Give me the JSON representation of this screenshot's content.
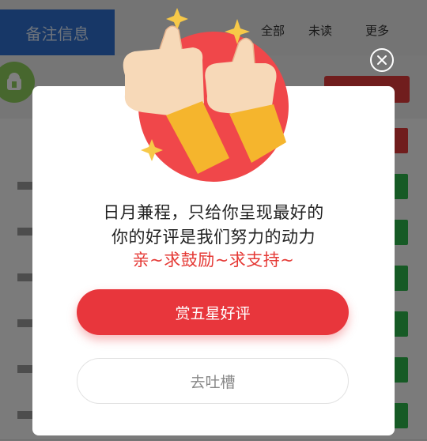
{
  "background": {
    "blue_button_label": "备注信息",
    "tabs": [
      "全部",
      "未读",
      "更多"
    ]
  },
  "dialog": {
    "message_line1": "日月兼程，只给你呈现最好的",
    "message_line2": "你的好评是我们努力的动力",
    "message_line3": "亲~求鼓励~求支持~",
    "primary_button": "赏五星好评",
    "secondary_button": "去吐槽"
  },
  "colors": {
    "accent_red": "#e8363c",
    "hero_circle": "#f0474a",
    "sleeve_yellow": "#f5b52d",
    "skin": "#f7d9b8",
    "sparkle": "#f7c948"
  },
  "icons": {
    "close": "close-icon",
    "hero": "thumbs-up-illustration",
    "app_avatar": "android-icon"
  }
}
